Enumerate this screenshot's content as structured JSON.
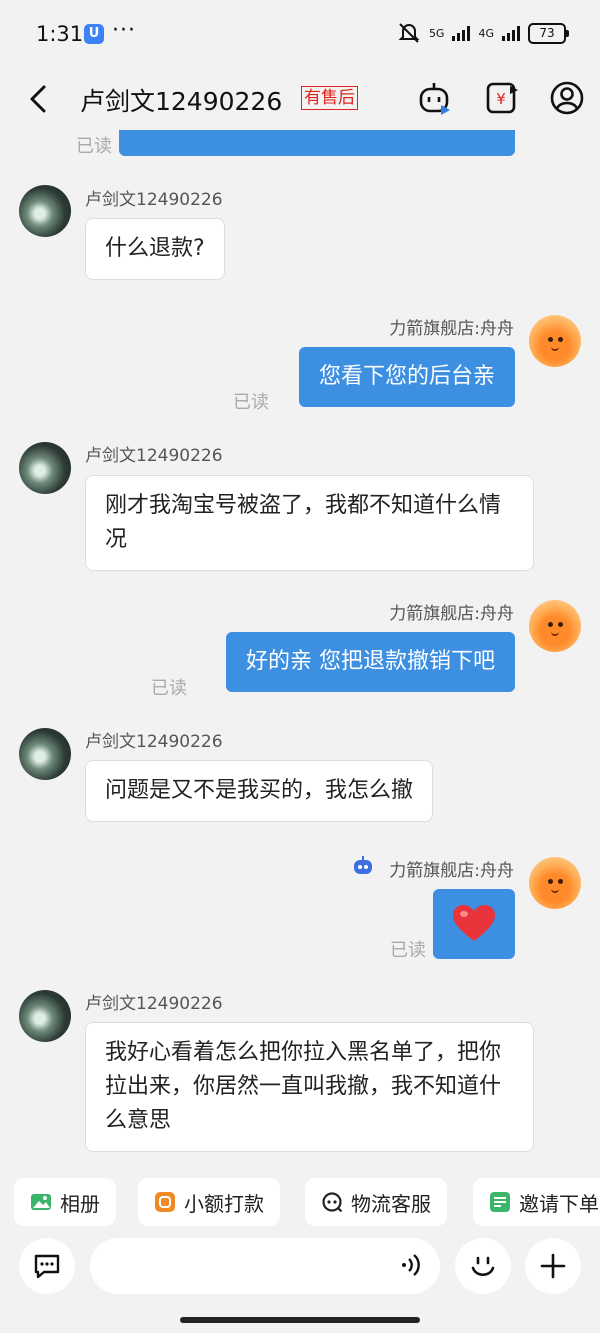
{
  "status": {
    "time": "1:31",
    "app_badge": "U",
    "more": "···",
    "net1": "5G",
    "net2": "4G",
    "battery": "73"
  },
  "header": {
    "title": "卢剑文12490226",
    "badge": "有售后"
  },
  "chat": {
    "customer_name": "卢剑文12490226",
    "shop_name": "力箭旗舰店:舟舟",
    "read_label": "已读",
    "messages": [
      {
        "side": "left",
        "text": "什么退款?"
      },
      {
        "side": "right",
        "text": "您看下您的后台亲",
        "status": "已读"
      },
      {
        "side": "left",
        "text": "刚才我淘宝号被盗了，我都不知道什么情况"
      },
      {
        "side": "right",
        "text": "好的亲 您把退款撤销下吧",
        "status": "已读"
      },
      {
        "side": "left",
        "text": "问题是又不是我买的，我怎么撤"
      },
      {
        "side": "right",
        "sticker": "heart-icon",
        "status": "已读"
      },
      {
        "side": "left",
        "text": "我好心看着怎么把你拉入黑名单了，把你拉出来，你居然一直叫我撤，我不知道什么意思"
      }
    ]
  },
  "quick_actions": [
    {
      "label": "相册",
      "icon": "image-icon",
      "color": "#3bb56a"
    },
    {
      "label": "小额打款",
      "icon": "payment-icon",
      "color": "#f08a24"
    },
    {
      "label": "物流客服",
      "icon": "logistics-service-icon",
      "color": "#222222"
    },
    {
      "label": "邀请下单",
      "icon": "invite-order-icon",
      "color": "#3bb56a"
    }
  ],
  "input": {
    "placeholder": ""
  },
  "colors": {
    "accent": "#3d8fe2",
    "badge_red": "#e0241b",
    "background": "#f2f2f2"
  }
}
